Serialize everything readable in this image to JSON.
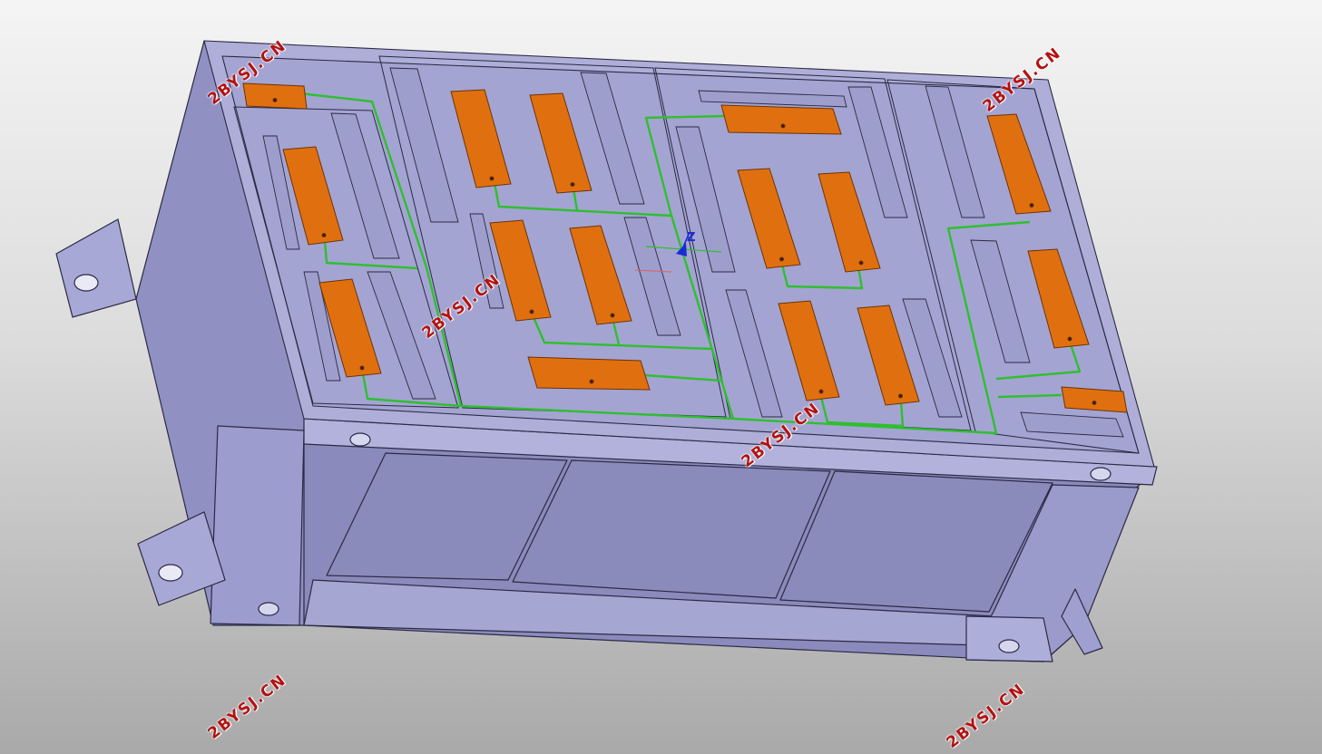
{
  "watermarks": {
    "top_left": "2BYSJ.CN",
    "top_right": "2BYSJ.CN",
    "center_left": "2BYSJ.CN",
    "center": "2BYSJ.CN",
    "bottom_left": "2BYSJ.CN",
    "bottom_right": "2BYSJ.CN"
  },
  "axis_triad": {
    "z_label": "Z"
  },
  "colors": {
    "housing_top": "#a9a9d4",
    "housing_side": "#8e8ec0",
    "housing_dark": "#7474a6",
    "edge": "#2a2a44",
    "cell": "#e0700f",
    "cell_edge": "#6b3206",
    "wire": "#2fbf2f"
  }
}
